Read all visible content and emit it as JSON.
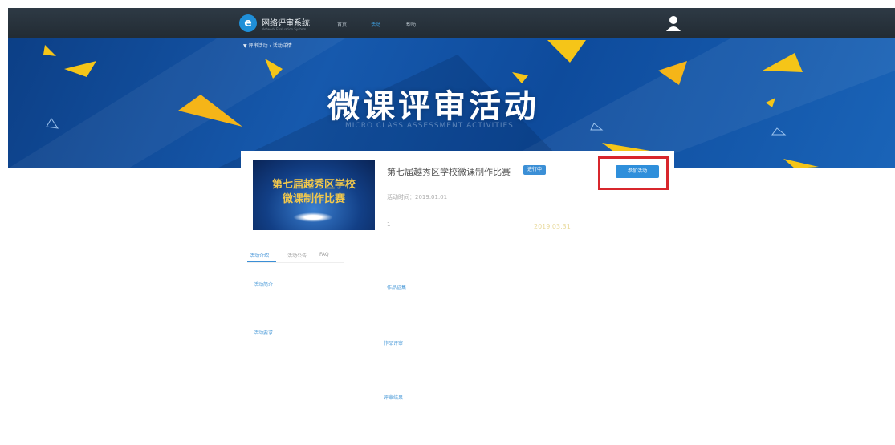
{
  "header": {
    "logo_letter": "e",
    "app_title": "网络评审系统",
    "app_subtitle": "Network Evaluation System",
    "nav": [
      {
        "label": "首页"
      },
      {
        "label": "活动"
      },
      {
        "label": "帮助"
      }
    ]
  },
  "banner": {
    "breadcrumb": "▼ 评审活动 › 活动详情",
    "title": "微课评审活动",
    "subtitle": "MICRO CLASS ASSESSMENT ACTIVITIES"
  },
  "contest": {
    "thumbnail_line1": "第七届越秀区学校",
    "thumbnail_line2": "微课制作比赛",
    "title": "第七届越秀区学校微课制作比赛",
    "badge": "进行中",
    "meta1": "活动时间：2019.01.01",
    "meta2": "1",
    "date_highlight": "2019.03.31",
    "join_button": "参加活动"
  },
  "tabs": [
    {
      "label": "活动介绍"
    },
    {
      "label": "活动公告"
    },
    {
      "label": "FAQ"
    }
  ],
  "links": {
    "left": [
      "活动简介",
      "活动要求"
    ],
    "right": [
      "作品征集",
      "作品评审",
      "评审结果"
    ]
  },
  "colors": {
    "accent": "#2f8fdb",
    "highlight_border": "#d8262c",
    "topbar": "#2a343e",
    "banner": "#1659ad"
  }
}
